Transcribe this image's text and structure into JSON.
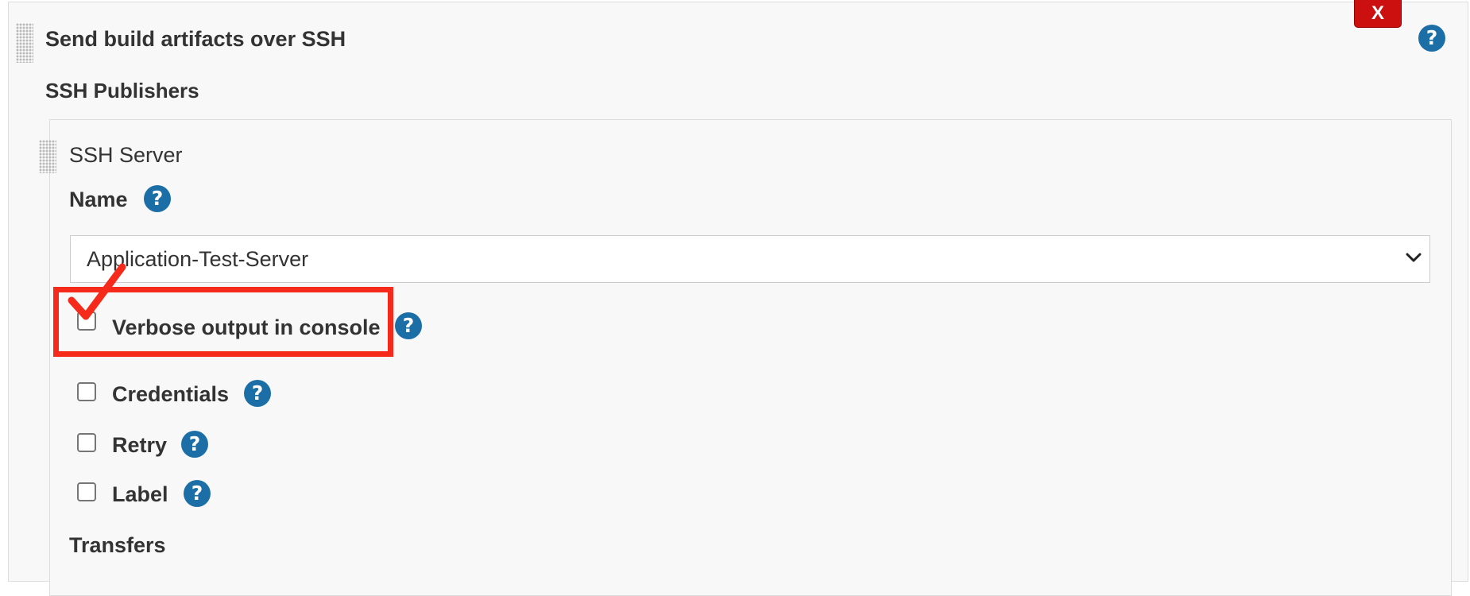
{
  "section": {
    "title": "Send build artifacts over SSH",
    "delete_label": "X",
    "help_glyph": "?"
  },
  "publishers": {
    "title": "SSH Publishers"
  },
  "server": {
    "title": "SSH Server",
    "name_label": "Name",
    "name_value": "Application-Test-Server"
  },
  "options": {
    "verbose_label": "Verbose output in console",
    "verbose_checked": false,
    "credentials_label": "Credentials",
    "credentials_checked": false,
    "retry_label": "Retry",
    "retry_checked": false,
    "label_label": "Label",
    "label_checked": false
  },
  "transfers": {
    "title": "Transfers"
  },
  "annotation": {
    "highlight_color": "#f52a1a",
    "mark": "red-checkmark"
  },
  "colors": {
    "help_icon": "#1c6fa6",
    "delete_button": "#cc1010",
    "panel_background": "#f8f8f8"
  },
  "icons": [
    "grip-handle-icon",
    "close-icon",
    "help-icon",
    "chevron-down-icon",
    "checkbox-icon"
  ]
}
